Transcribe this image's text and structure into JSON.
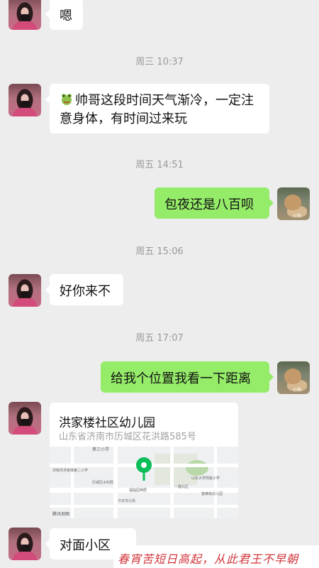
{
  "messages": [
    {
      "text": "嗯"
    },
    {
      "time": "周三 10:37"
    },
    {
      "text_line1": "帅哥这段时间天气渐冷，一定注",
      "text_line2": "意身体，有时间过来玩"
    },
    {
      "time": "周五 14:51"
    },
    {
      "text": "包夜还是八百呗"
    },
    {
      "time": "周五 15:06"
    },
    {
      "text": "好你来不"
    },
    {
      "time": "周五 17:07"
    },
    {
      "text": "给我个位置我看一下距离"
    },
    {
      "location": {
        "title": "洪家楼社区幼儿园",
        "address": "山东省济南市历城区花洪路585号",
        "map_brand": "腾讯地图"
      }
    },
    {
      "text": "对面小区"
    }
  ],
  "map_labels": {
    "l1": "第三小学",
    "l2": "山东大学附属小学",
    "l3": "济南市洪家楼第二小学",
    "l4": "历城区水利局",
    "l5": "福临园神居",
    "l6": "一建北区",
    "l7": "蜜蜂班幼儿园",
    "l8": "洪家楼北路"
  },
  "dog_tag": "小狗",
  "banner_text": "春宵苦短日高起，从此君王不早朝"
}
